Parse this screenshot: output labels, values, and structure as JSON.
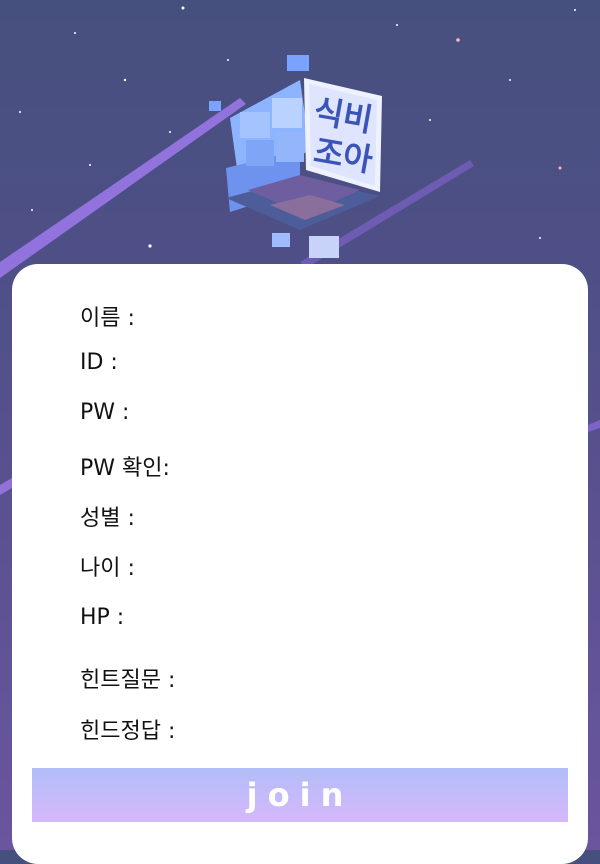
{
  "logo": {
    "line1": "식비",
    "line2": "조아"
  },
  "form": {
    "fields": [
      {
        "label": "이름 :"
      },
      {
        "label": "ID :"
      },
      {
        "label": "PW :"
      },
      {
        "label": "PW 확인:"
      },
      {
        "label": "성별 :"
      },
      {
        "label": "나이 :"
      },
      {
        "label": "HP :"
      },
      {
        "label": "힌트질문 :"
      },
      {
        "label": "힌드정답 :"
      }
    ],
    "join_label": "join"
  },
  "colors": {
    "background_top": "#46507e",
    "background_bottom": "#6a559e",
    "button_top": "#b2bdf8",
    "button_bottom": "#d6b8fb"
  }
}
